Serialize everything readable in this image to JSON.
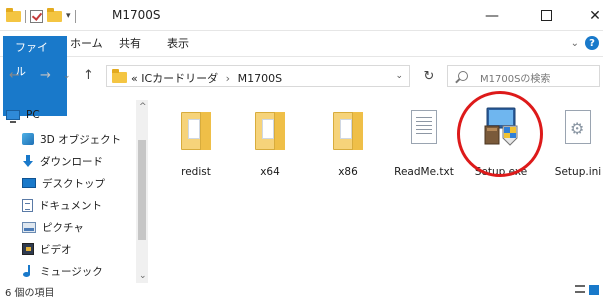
{
  "window": {
    "title": "M1700S",
    "min_glyph": "—",
    "close_glyph": "✕"
  },
  "quick_access": {
    "dropdown_glyph": "▾"
  },
  "ribbon": {
    "tabs": [
      "ファイル",
      "ホーム",
      "共有",
      "表示"
    ],
    "expand_glyph": "⌄",
    "help_glyph": "?"
  },
  "address": {
    "back_glyph": "←",
    "forward_glyph": "→",
    "recent_glyph": "⌄",
    "up_glyph": "↑",
    "overflow": "«",
    "crumbs": [
      "ICカードリーダ",
      "M1700S"
    ],
    "separator": "›",
    "dropdown_glyph": "⌄",
    "refresh_glyph": "↻",
    "search_placeholder": "M1700Sの検索"
  },
  "sidebar": {
    "items": [
      {
        "label": "PC",
        "icon": "pc-icon"
      },
      {
        "label": "3D オブジェクト",
        "icon": "3d-objects-icon"
      },
      {
        "label": "ダウンロード",
        "icon": "downloads-icon"
      },
      {
        "label": "デスクトップ",
        "icon": "desktop-icon"
      },
      {
        "label": "ドキュメント",
        "icon": "documents-icon"
      },
      {
        "label": "ピクチャ",
        "icon": "pictures-icon"
      },
      {
        "label": "ビデオ",
        "icon": "videos-icon"
      },
      {
        "label": "ミュージック",
        "icon": "music-icon"
      }
    ],
    "scroll_up": "^",
    "scroll_down": "⌄"
  },
  "files": [
    {
      "name": "redist",
      "type": "folder"
    },
    {
      "name": "x64",
      "type": "folder"
    },
    {
      "name": "x86",
      "type": "folder"
    },
    {
      "name": "ReadMe.txt",
      "type": "text"
    },
    {
      "name": "Setup.exe",
      "type": "installer",
      "highlighted": true
    },
    {
      "name": "Setup.ini",
      "type": "ini"
    }
  ],
  "highlight_color": "#dd1a1a",
  "status": {
    "item_count": "6 個の項目"
  }
}
